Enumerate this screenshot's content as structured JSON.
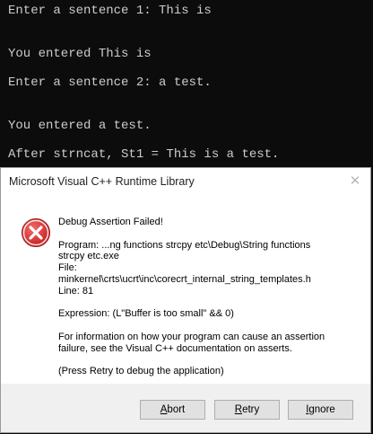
{
  "console": {
    "lines": [
      "Enter a sentence 1: This is",
      "You entered This is",
      "Enter a sentence 2: a test.",
      "You entered a test.",
      "After strncat, St1 = This is a test."
    ]
  },
  "dialog": {
    "title": "Microsoft Visual C++ Runtime Library",
    "close_glyph": "✕",
    "icon": "error-icon",
    "heading": "Debug Assertion Failed!",
    "program_label": "Program: ...ng functions strcpy etc\\Debug\\String functions",
    "program_cont": "strcpy etc.exe",
    "file_label": "File:",
    "file_path": "minkernel\\crts\\ucrt\\inc\\corecrt_internal_string_templates.h",
    "line_label": "Line: 81",
    "expression": "Expression: (L\"Buffer is too small\" && 0)",
    "info_line1": "For information on how your program can cause an assertion",
    "info_line2": "failure, see the Visual C++ documentation on asserts.",
    "retry_hint": "(Press Retry to debug the application)",
    "buttons": {
      "abort_accel": "A",
      "abort_rest": "bort",
      "retry_accel": "R",
      "retry_rest": "etry",
      "ignore_accel": "I",
      "ignore_rest": "gnore"
    }
  },
  "colors": {
    "console_bg": "#0c0c0c",
    "console_text": "#cccccc",
    "error_red": "#d32f2f"
  }
}
